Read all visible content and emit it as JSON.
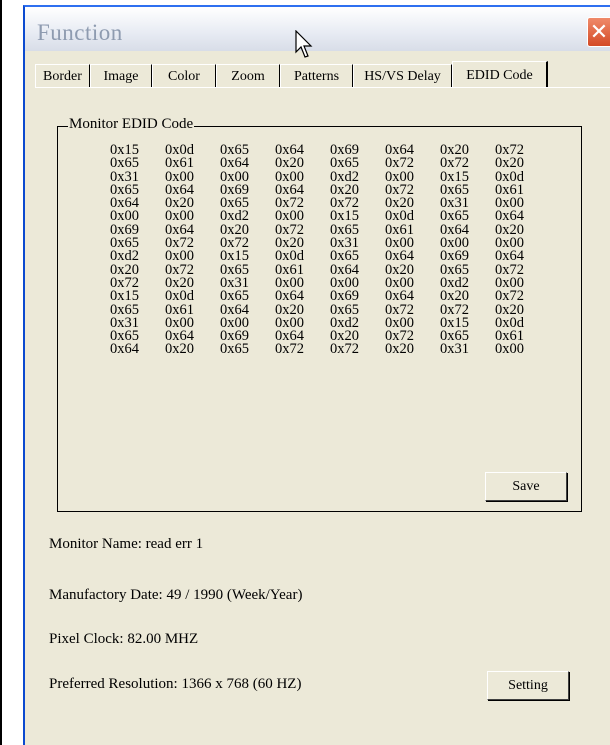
{
  "window": {
    "title": "Function",
    "close_icon": "close-icon"
  },
  "tabs": [
    "Border",
    "Image",
    "Color",
    "Zoom",
    "Patterns",
    "HS/VS Delay",
    "EDID Code"
  ],
  "active_tab": "EDID Code",
  "edid": {
    "group_label": "Monitor EDID Code",
    "rows": [
      [
        "0x15",
        "0x0d",
        "0x65",
        "0x64",
        "0x69",
        "0x64",
        "0x20",
        "0x72"
      ],
      [
        "0x65",
        "0x61",
        "0x64",
        "0x20",
        "0x65",
        "0x72",
        "0x72",
        "0x20"
      ],
      [
        "0x31",
        "0x00",
        "0x00",
        "0x00",
        "0xd2",
        "0x00",
        "0x15",
        "0x0d"
      ],
      [
        "0x65",
        "0x64",
        "0x69",
        "0x64",
        "0x20",
        "0x72",
        "0x65",
        "0x61"
      ],
      [
        "0x64",
        "0x20",
        "0x65",
        "0x72",
        "0x72",
        "0x20",
        "0x31",
        "0x00"
      ],
      [
        "0x00",
        "0x00",
        "0xd2",
        "0x00",
        "0x15",
        "0x0d",
        "0x65",
        "0x64"
      ],
      [
        "0x69",
        "0x64",
        "0x20",
        "0x72",
        "0x65",
        "0x61",
        "0x64",
        "0x20"
      ],
      [
        "0x65",
        "0x72",
        "0x72",
        "0x20",
        "0x31",
        "0x00",
        "0x00",
        "0x00"
      ],
      [
        "0xd2",
        "0x00",
        "0x15",
        "0x0d",
        "0x65",
        "0x64",
        "0x69",
        "0x64"
      ],
      [
        "0x20",
        "0x72",
        "0x65",
        "0x61",
        "0x64",
        "0x20",
        "0x65",
        "0x72"
      ],
      [
        "0x72",
        "0x20",
        "0x31",
        "0x00",
        "0x00",
        "0x00",
        "0xd2",
        "0x00"
      ],
      [
        "0x15",
        "0x0d",
        "0x65",
        "0x64",
        "0x69",
        "0x64",
        "0x20",
        "0x72"
      ],
      [
        "0x65",
        "0x61",
        "0x64",
        "0x20",
        "0x65",
        "0x72",
        "0x72",
        "0x20"
      ],
      [
        "0x31",
        "0x00",
        "0x00",
        "0x00",
        "0xd2",
        "0x00",
        "0x15",
        "0x0d"
      ],
      [
        "0x65",
        "0x64",
        "0x69",
        "0x64",
        "0x20",
        "0x72",
        "0x65",
        "0x61"
      ],
      [
        "0x64",
        "0x20",
        "0x65",
        "0x72",
        "0x72",
        "0x20",
        "0x31",
        "0x00"
      ]
    ],
    "save_label": "Save"
  },
  "info": {
    "monitor_name": "Monitor Name: read err 1",
    "manufactory_date": "Manufactory Date: 49 / 1990 (Week/Year)",
    "pixel_clock": "Pixel Clock: 82.00 MHZ",
    "preferred_resolution": "Preferred Resolution: 1366 x 768 (60 HZ)",
    "setting_label": "Setting"
  },
  "colors": {
    "window_bg": "#ece9d8",
    "close_button": "#d44a26",
    "title_text": "#8e9bb0"
  }
}
